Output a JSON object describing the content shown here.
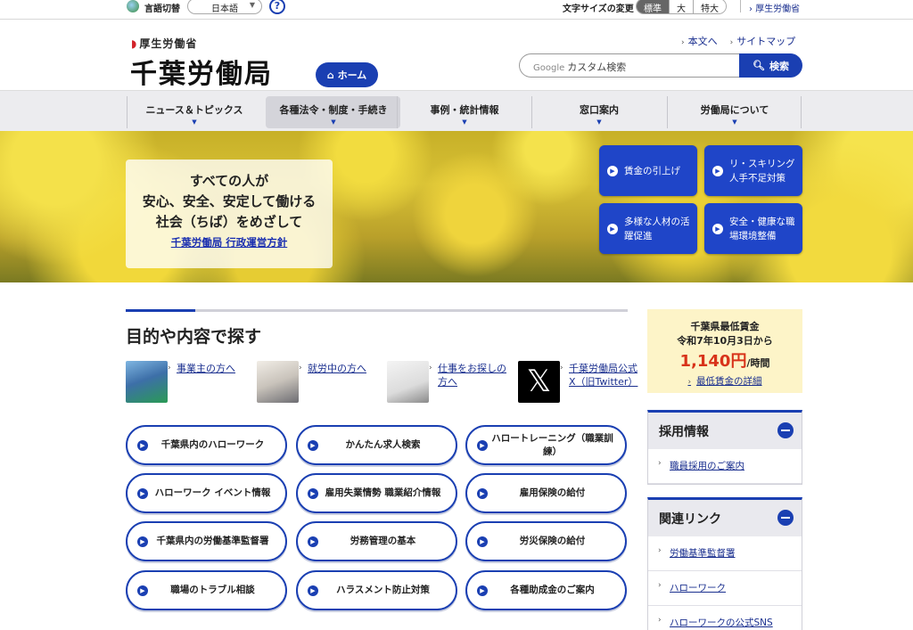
{
  "topbar": {
    "lang_label": "言語切替",
    "lang_value": "日本語",
    "help": "?",
    "font_size_label": "文字サイズの変更",
    "font_sizes": [
      "標準",
      "大",
      "特大"
    ],
    "mhlw_link": "厚生労働省"
  },
  "header": {
    "ministry": "厚生労働省",
    "bureau": "千葉労働局",
    "home_button": "ホーム",
    "links": [
      "本文へ",
      "サイトマップ"
    ],
    "search_placeholder": "カスタム検索",
    "search_brand": "Google",
    "search_button": "検索"
  },
  "gnav": [
    "ニュース＆トピックス",
    "各種法令・制度・手続き",
    "事例・統計情報",
    "窓口案内",
    "労働局について"
  ],
  "hero": {
    "lines": [
      "すべての人が",
      "安心、安全、安定して働ける",
      "社会（ちば）をめざして"
    ],
    "link": "千葉労働局 行政運営方針",
    "buttons": [
      "賃金の引上げ",
      "リ・スキリング\n人手不足対策",
      "多様な人材の活躍促進",
      "安全・健康な職場環境整備"
    ]
  },
  "section": {
    "title": "目的や内容で探す",
    "categories": [
      "事業主の方へ",
      "就労中の方へ",
      "仕事をお探しの方へ",
      "千葉労働局公式X（旧Twitter）"
    ],
    "pills": [
      "千葉県内のハローワーク",
      "かんたん求人検索",
      "ハロートレーニング（職業訓練）",
      "ハローワーク イベント情報",
      "雇用失業情勢 職業紹介情報",
      "雇用保険の給付",
      "千葉県内の労働基準監督署",
      "労務管理の基本",
      "労災保険の給付",
      "職場のトラブル相談",
      "ハラスメント防止対策",
      "各種助成金のご案内"
    ]
  },
  "wage": {
    "title": "千葉県最低賃金",
    "date": "令和7年10月3日から",
    "amount": "1,140円",
    "unit": "/時間",
    "link": "最低賃金の詳細"
  },
  "recruit": {
    "title": "採用情報",
    "items": [
      "職員採用のご案内"
    ]
  },
  "related": {
    "title": "関連リンク",
    "items": [
      "労働基準監督署",
      "ハローワーク",
      "ハローワークの公式SNS"
    ]
  },
  "colors": {
    "primary": "#1a3fb2",
    "wage_red": "#d8331a",
    "wage_bg": "#fdf4c8"
  }
}
